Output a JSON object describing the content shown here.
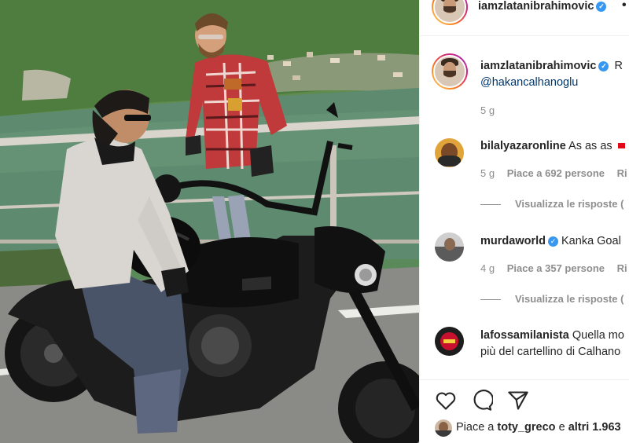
{
  "post_image_alt_icons": [
    "bike-photo"
  ],
  "header": {
    "username": "iamzlatanibrahimovic",
    "trailing": "•"
  },
  "caption": {
    "username": "iamzlatanibrahimovic",
    "text_tail": "R",
    "mention": "@hakancalhanoglu",
    "time": "5 g"
  },
  "comments": [
    {
      "username": "bilalyazaronline",
      "text": "As as as",
      "time": "5 g",
      "likes": "Piace a 692 persone",
      "reply": "Ri",
      "view_replies": "Visualizza le risposte ("
    },
    {
      "username": "murdaworld",
      "verified": true,
      "text": "Kanka Goal",
      "time": "4 g",
      "likes": "Piace a 357 persone",
      "reply": "Ri",
      "view_replies": "Visualizza le risposte ("
    },
    {
      "username": "lafossamilanista",
      "text": "Quella mo",
      "text_line2": "più del cartellino di Calhano"
    }
  ],
  "actions": {
    "like_icon": "heart-icon",
    "comment_icon": "comment-icon",
    "share_icon": "paper-plane-icon"
  },
  "liked_by": {
    "prefix": "Piace a",
    "user": "toty_greco",
    "joiner": "e",
    "others": "altri 1.963"
  },
  "colors": {
    "link": "#00376b",
    "muted": "#8e8e8e",
    "verified": "#3897f0",
    "border": "#efefef"
  }
}
